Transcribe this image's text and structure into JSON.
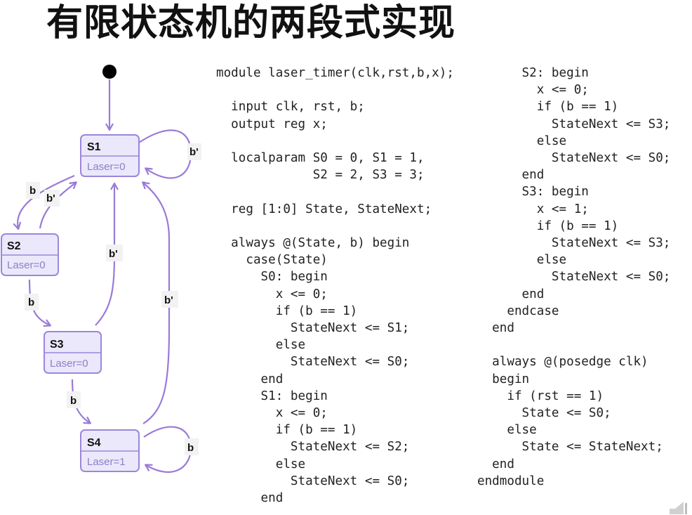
{
  "title": "有限状态机的两段式实现",
  "states": [
    {
      "name": "S1",
      "output": "Laser=0"
    },
    {
      "name": "S2",
      "output": "Laser=0"
    },
    {
      "name": "S3",
      "output": "Laser=0"
    },
    {
      "name": "S4",
      "output": "Laser=1"
    }
  ],
  "edge_labels": {
    "s1_self": "b'",
    "s1_to_s2": "b",
    "s2_to_s1": "b'",
    "s2_to_s3": "b",
    "s3_to_s1": "b'",
    "s3_to_s4": "b",
    "s4_to_s1": "b'",
    "s4_self": "b"
  },
  "code_left": "module laser_timer(clk,rst,b,x);\n\n  input clk, rst, b;\n  output reg x;\n\n  localparam S0 = 0, S1 = 1,\n             S2 = 2, S3 = 3;\n\n  reg [1:0] State, StateNext;\n\n  always @(State, b) begin\n    case(State)\n      S0: begin\n        x <= 0;\n        if (b == 1)\n          StateNext <= S1;\n        else\n          StateNext <= S0;\n      end\n      S1: begin\n        x <= 0;\n        if (b == 1)\n          StateNext <= S2;\n        else\n          StateNext <= S0;\n      end",
  "code_right": "      S2: begin\n        x <= 0;\n        if (b == 1)\n          StateNext <= S3;\n        else\n          StateNext <= S0;\n      end\n      S3: begin\n        x <= 1;\n        if (b == 1)\n          StateNext <= S3;\n        else\n          StateNext <= S0;\n      end\n    endcase\n  end\n\n  always @(posedge clk)\n  begin\n    if (rst == 1)\n      State <= S0;\n    else\n      State <= StateNext;\n  end\nendmodule",
  "colors": {
    "state_fill": "#ebe8fb",
    "state_stroke": "#9b86db",
    "edge": "#9a7ad8",
    "output_text": "#8e7fc6"
  }
}
